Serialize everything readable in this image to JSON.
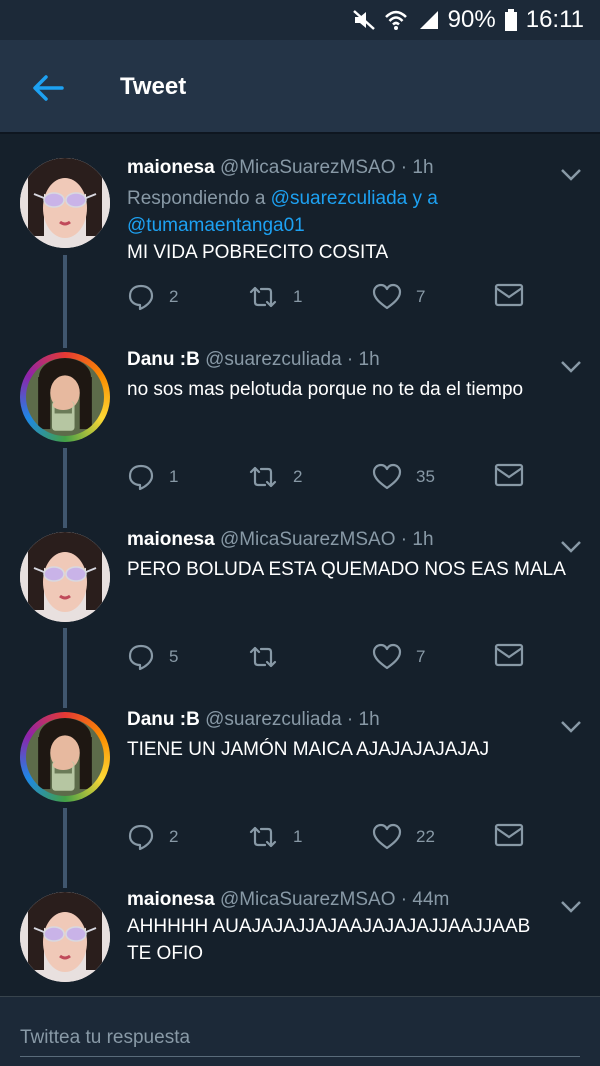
{
  "status": {
    "battery": "90%",
    "time": "16:11"
  },
  "header": {
    "title": "Tweet"
  },
  "tweets": [
    {
      "name": "maionesa",
      "handle": "@MicaSuarezMSAO",
      "dot": "·",
      "time": "1h",
      "reply_prefix": "Respondiendo a ",
      "reply_user1": "@suarezculiada",
      "reply_mid": " y a",
      "reply_user2": "@tumamaentanga01",
      "text": "MI VIDA POBRECITO COSITA",
      "replies": "2",
      "retweets": "1",
      "likes": "7"
    },
    {
      "name": "Danu :B",
      "handle": "@suarezculiada",
      "dot": "·",
      "time": "1h",
      "text": "no sos mas pelotuda porque no te da el tiempo",
      "replies": "1",
      "retweets": "2",
      "likes": "35"
    },
    {
      "name": "maionesa",
      "handle": "@MicaSuarezMSAO",
      "dot": "·",
      "time": "1h",
      "text": "PERO BOLUDA ESTA QUEMADO NOS EAS MALA",
      "replies": "5",
      "retweets": "",
      "likes": "7"
    },
    {
      "name": "Danu :B",
      "handle": "@suarezculiada",
      "dot": "·",
      "time": "1h",
      "text": "TIENE UN JAMÓN MAICA AJAJAJAJAJAJ",
      "replies": "2",
      "retweets": "1",
      "likes": "22"
    },
    {
      "name": "maionesa",
      "handle": "@MicaSuarezMSAO",
      "dot": "·",
      "time": "44m",
      "text_line1": "AHHHHH AUAJAJAJJAJAAJAJAJAJJAAJJAAB",
      "text_line2": "TE OFIO"
    }
  ],
  "compose": {
    "placeholder": "Twittea tu respuesta"
  },
  "colors": {
    "background": "#15202b",
    "appbar": "#243447",
    "accent": "#1da1f2",
    "muted": "#8899a6"
  }
}
